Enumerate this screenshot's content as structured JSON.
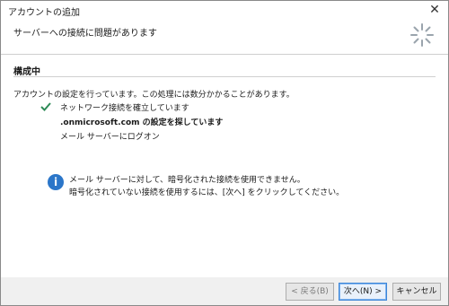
{
  "window": {
    "title": "アカウントの追加",
    "close_glyph": "✕"
  },
  "header": {
    "title": "サーバーへの接続に問題があります"
  },
  "section": {
    "title": "構成中"
  },
  "status": {
    "message": "アカウントの設定を行っています。この処理には数分かかることがあります。"
  },
  "tasks": [
    {
      "label": "ネットワーク接続を確立しています",
      "icon": "check-icon"
    },
    {
      "label": ".onmicrosoft.com の設定を探しています",
      "icon": "none"
    },
    {
      "label": "メール サーバーにログオン",
      "icon": "none"
    }
  ],
  "info": {
    "icon": "i",
    "line1": "メール サーバーに対して、暗号化された接続を使用できません。",
    "line2": "暗号化されていない接続を使用するには、[次へ] をクリックしてください。"
  },
  "footer": {
    "back": "< 戻る(B)",
    "next": "次へ(N) >",
    "cancel": "キャンセル"
  },
  "colors": {
    "accent": "#2b76c9",
    "check": "#2e8b57"
  }
}
